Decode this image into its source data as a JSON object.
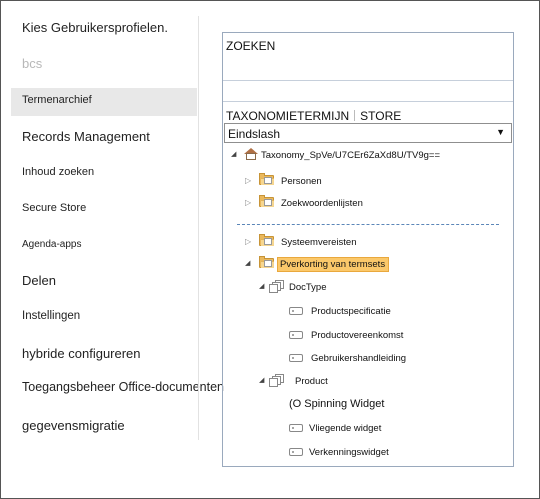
{
  "nav": {
    "items": [
      {
        "label": "Kies Gebruikersprofielen.",
        "color": "#222222"
      },
      {
        "label": "bcs",
        "color": "#b8b8b8"
      },
      {
        "label": "Termenarchief",
        "selected": true
      },
      {
        "label": "Records Management"
      },
      {
        "label": "Inhoud zoeken"
      },
      {
        "label": "Secure Store"
      },
      {
        "label": "Agenda-apps"
      },
      {
        "label": "Delen"
      },
      {
        "label": "Instellingen"
      },
      {
        "label": "hybride configureren"
      },
      {
        "label": "Toegangsbeheer Office-documenten"
      },
      {
        "label": "gegevensmigratie"
      }
    ]
  },
  "panel": {
    "search_label": "ZOEKEN",
    "tabs": [
      "TAXONOMIETERMIJN",
      "STORE"
    ],
    "dropdown": {
      "value": "Eindslash"
    },
    "tree": {
      "root": "Taxonomy_SpVe/U7CEr6ZaXd8U/TV9g==",
      "groups": [
        "Personen",
        "Zoekwoordenlijsten",
        "Systeemvereisten",
        "Pverkorting van termsets"
      ],
      "termsets": [
        {
          "name": "DocType",
          "terms": [
            "Productspecificatie",
            "Productovereenkomst",
            "Gebruikershandleiding"
          ]
        },
        {
          "name": "Product",
          "terms": [
            "(O Spinning Widget",
            "Vliegende widget",
            "Verkenningswidget"
          ]
        }
      ]
    }
  },
  "colors": {
    "selected_nav_bg": "#e8e8e8",
    "highlight": "#fbc86a",
    "panel_border": "#9aa9bd",
    "folder": "#eab85c"
  }
}
